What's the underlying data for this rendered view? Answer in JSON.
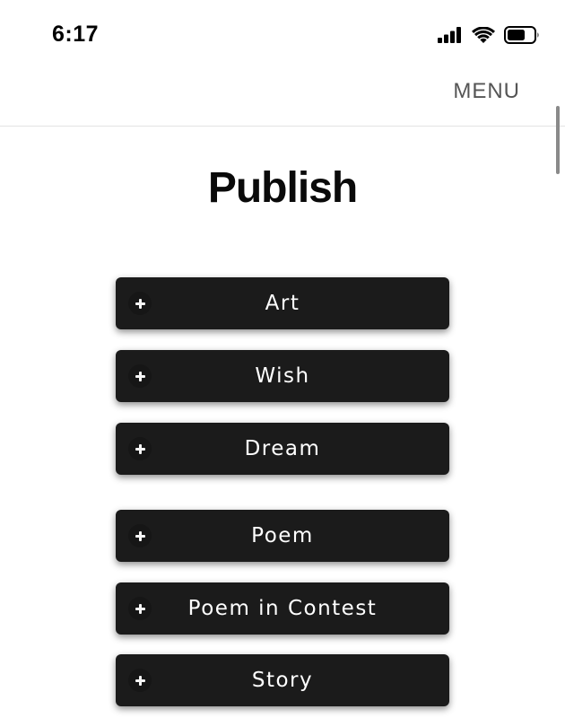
{
  "status_bar": {
    "time": "6:17"
  },
  "header": {
    "menu_label": "MENU"
  },
  "page": {
    "title": "Publish"
  },
  "buttons": [
    {
      "label": "Art"
    },
    {
      "label": "Wish"
    },
    {
      "label": "Dream"
    },
    {
      "label": "Poem"
    },
    {
      "label": "Poem in Contest"
    },
    {
      "label": "Story"
    }
  ]
}
